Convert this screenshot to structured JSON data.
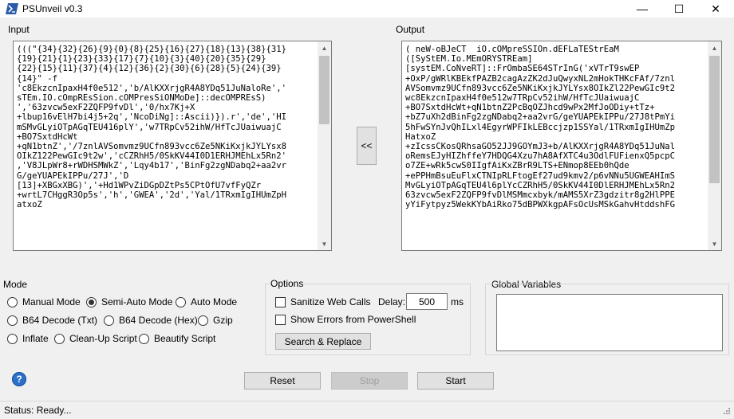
{
  "window": {
    "title": "PSUnveil v0.3",
    "icon": "powershell-icon",
    "minimize_glyph": "—",
    "maximize_glyph": "☐",
    "close_glyph": "✕"
  },
  "input": {
    "label": "Input",
    "text": "(((\"{34}{32}{26}{9}{0}{8}{25}{16}{27}{18}{13}{38}{31}\n{19}{21}{1}{23}{33}{17}{7}{10}{3}{40}{20}{35}{29}\n{22}{15}{11}{37}{4}{12}{36}{2}{30}{6}{28}{5}{24}{39}\n{14}\" -f\n'c8EkzcnIpaxH4f0e512','b/AlKXXrjgR4A8YDq51JuNaloRe','\nsTEm.IO.cOmpREsSion.cOMPresSiONMoDe]::decOMPREsS)\n','63zvcw5exF2ZQFP9fvDl','0/hx7Kj+X\n+lbup16vElH7bi4j5+2q','NcoDiNg]::Ascii)}).r','de','HI\nmSMvGLyiOTpAGqTEU416plY','w7TRpCv52ihW/HfTcJUaiwuajC\n+BO7SxtdHcWt\n+qN1btnZ','/7znlAVSomvmz9UCfn893vcc6Ze5NKiKxjkJYLYsx8\nOIkZ122PewGIc9t2w','cCZRhH5/0SkKV44I0D1ERHJMEhLx5Rn2'\n,'V8JLpWr8+rWDHSMWkZ','Lqy4b17','BinFg2zgNDabq2+aa2vr\nG/geYUAPEkIPPu/27J','D\n[13]+XBGxXBG)','+Hd1WPvZiDGpDZtPs5CPtOfU7vfFyQZr\n+wrtL7CHggR3Op5s','h','GWEA','2d','Yal/1TRxmIgIHUmZpH\natxoZ"
  },
  "output": {
    "label": "Output",
    "text": "( neW-oBJeCT  iO.cOMpreSSIOn.dEFLaTEStrEaM\n([SyStEM.Io.MEmORYSTREam]\n[systEM.CoNveRT]::FrOmbaSE64STrInG('xVTrT9swEP\n+OxP/gWRlKBEkfPAZB2cagAzZK2dJuQwyxNL2mHokTHKcFAf/7znl\nAVSomvmz9UCfn893vcc6Ze5NKiKxjkJYLYsx8OIkZl22PewGIc9t2\nwc8EkzcnIpaxH4f0e512w7TRpCv52ihW/HfTcJUaiwuajC\n+BO7SxtdHcWt+qN1btnZ2PcBqOZJhcd9wPx2MfJoODiy+tTz+\n+bZ7uXh2dBinFg2zgNDabq2+aa2vrG/geYUAPEkIPPu/27J8tPmYi\n5hFwSYnJvQhILxl4EgyrWPFIkLEBccjzp1SSYal/1TRxmIgIHUmZp\nHatxoZ\n+zIcssCKosQRhsaGO52JJ9GOYmJ3+b/AlKXXrjgR4A8YDq51JuNal\noRemsEJyHIZhffeY7HDQG4Xzu7hA8AfXTC4u3OdlFUFienxQ5pcpC\no7ZE+wRk5cwS0IIgfAiKxZBrR9LTS+ENmop8EEb0hQde\n+ePPHmBsuEuFlxCTNIpRLFtogEf27ud9kmv2/p6vNNu5UGWEAHImS\nMvGLyiOTpAGqTEU4l6plYcCZRhH5/0SkKV44I0DlERHJMEhLx5Rn2\n63zvcw5exF2ZQFP9fvDlMSMmcxbyk/mAMS5XrZ3gdzitr8g2HlPPE\nyYiFytpyz5WekKYbAiRko75dBPWXkgpAFsOcUsMSkGahvHtddshFG"
  },
  "transfer_button": {
    "label": "<<"
  },
  "mode": {
    "label": "Mode",
    "options": [
      {
        "label": "Manual Mode",
        "selected": false
      },
      {
        "label": "Semi-Auto Mode",
        "selected": true
      },
      {
        "label": "Auto Mode",
        "selected": false
      },
      {
        "label": "B64 Decode (Txt)",
        "selected": false
      },
      {
        "label": "B64 Decode (Hex)",
        "selected": false
      },
      {
        "label": "Gzip",
        "selected": false
      },
      {
        "label": "Inflate",
        "selected": false
      },
      {
        "label": "Clean-Up Script",
        "selected": false
      },
      {
        "label": "Beautify Script",
        "selected": false
      }
    ]
  },
  "options": {
    "label": "Options",
    "sanitize_label": "Sanitize Web Calls",
    "sanitize_checked": false,
    "delay_label": "Delay:",
    "delay_value": "500",
    "delay_unit": "ms",
    "errors_label": "Show Errors from PowerShell",
    "errors_checked": false,
    "search_replace_label": "Search & Replace"
  },
  "global_variables": {
    "label": "Global Variables",
    "value": ""
  },
  "actions": {
    "help_glyph": "?",
    "reset_label": "Reset",
    "stop_label": "Stop",
    "start_label": "Start"
  },
  "status": {
    "text": "Status: Ready..."
  }
}
